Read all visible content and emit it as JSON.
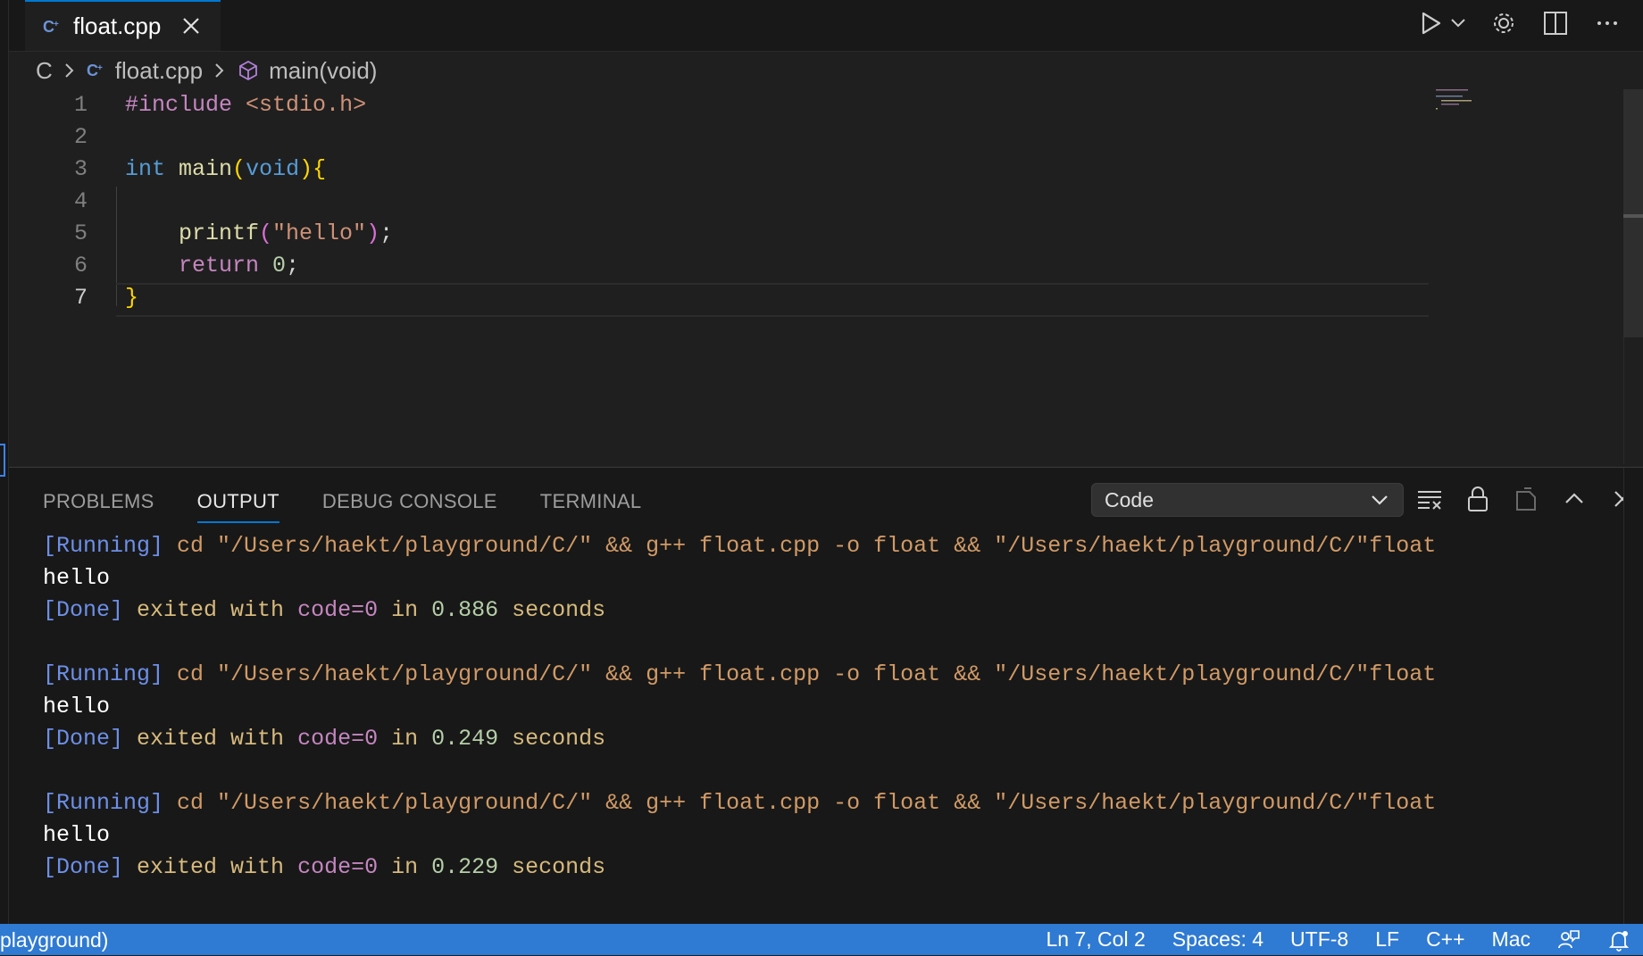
{
  "tab": {
    "title": "float.cpp"
  },
  "breadcrumb": {
    "folder": "C",
    "file": "float.cpp",
    "symbol": "main(void)"
  },
  "editor": {
    "line_numbers": [
      "1",
      "2",
      "3",
      "4",
      "5",
      "6",
      "7"
    ],
    "active_line": "7",
    "code": {
      "l1_directive": "#include",
      "l1_header": "<stdio.h>",
      "l3_type": "int",
      "l3_name": "main",
      "l3_open": "(",
      "l3_param": "void",
      "l3_close": ")",
      "l3_brace": "{",
      "l5_fn": "printf",
      "l5_open": "(",
      "l5_str": "\"hello\"",
      "l5_close": ")",
      "l5_semi": ";",
      "l6_kw": "return",
      "l6_num": "0",
      "l6_semi": ";",
      "l7_brace": "}"
    }
  },
  "panel": {
    "tabs": [
      "PROBLEMS",
      "OUTPUT",
      "DEBUG CONSOLE",
      "TERMINAL"
    ],
    "active_tab": "OUTPUT",
    "channel": "Code",
    "runs": [
      {
        "running_tag": "[Running]",
        "command": "cd \"/Users/haekt/playground/C/\" && g++ float.cpp -o float && \"/Users/haekt/playground/C/\"float",
        "output": "hello",
        "done_tag": "[Done]",
        "exited_with": "exited with",
        "code": "code=0",
        "in": "in",
        "seconds_value": "0.886",
        "seconds": "seconds"
      },
      {
        "running_tag": "[Running]",
        "command": "cd \"/Users/haekt/playground/C/\" && g++ float.cpp -o float && \"/Users/haekt/playground/C/\"float",
        "output": "hello",
        "done_tag": "[Done]",
        "exited_with": "exited with",
        "code": "code=0",
        "in": "in",
        "seconds_value": "0.249",
        "seconds": "seconds"
      },
      {
        "running_tag": "[Running]",
        "command": "cd \"/Users/haekt/playground/C/\" && g++ float.cpp -o float && \"/Users/haekt/playground/C/\"float",
        "output": "hello",
        "done_tag": "[Done]",
        "exited_with": "exited with",
        "code": "code=0",
        "in": "in",
        "seconds_value": "0.229",
        "seconds": "seconds"
      }
    ]
  },
  "statusbar": {
    "left": "playground)",
    "position": "Ln 7, Col 2",
    "spaces": "Spaces: 4",
    "encoding": "UTF-8",
    "eol": "LF",
    "language": "C++",
    "platform": "Mac"
  },
  "colors": {
    "accent": "#0078d4",
    "statusbar": "#2f7ad2",
    "editor_bg": "#1f1f1f"
  },
  "icons": [
    "cpp-file-icon",
    "close-icon",
    "run-icon",
    "chevron-down-icon",
    "gear-icon",
    "split-editor-icon",
    "more-icon",
    "symbol-method-icon",
    "chevron-right-icon",
    "clear-output-icon",
    "lock-icon",
    "open-in-editor-icon",
    "maximize-panel-icon",
    "feedback-icon",
    "bell-icon"
  ]
}
